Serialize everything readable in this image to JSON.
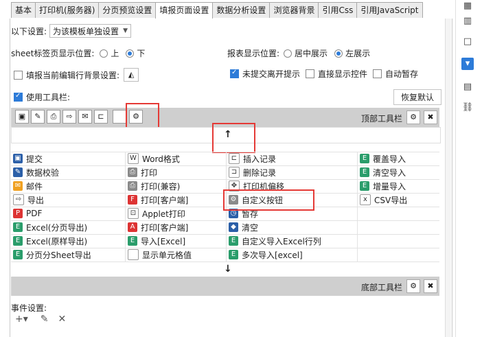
{
  "tabs": [
    "基本",
    "打印机(服务器)",
    "分页预览设置",
    "填报页面设置",
    "数据分析设置",
    "浏览器背景",
    "引用Css",
    "引用JavaScript"
  ],
  "active_tab_index": 3,
  "settings": {
    "label": "以下设置:",
    "select_value": "为该模板单独设置"
  },
  "sheet_tab": {
    "label": "sheet标签页显示位置:",
    "opt1": "上",
    "opt2": "下",
    "selected": "下"
  },
  "report_pos": {
    "label": "报表显示位置:",
    "opt1": "居中展示",
    "opt2": "左展示",
    "selected": "左展示"
  },
  "checks": {
    "fill_bg": "填报当前编辑行背景设置:",
    "unsubmitted": "未提交离开提示",
    "direct_ctrl": "直接显示控件",
    "autosave": "自动暂存",
    "toolbar": "使用工具栏:"
  },
  "restore_default": "恢复默认",
  "top_toolbar_label": "顶部工具栏",
  "bottom_toolbar_label": "底部工具栏",
  "toolbar_icons": [
    "save-icon",
    "verify-icon",
    "print-icon",
    "export-icon",
    "email-icon",
    "tree-icon",
    "blank-icon",
    "gear-icon"
  ],
  "grid": {
    "col1": [
      "提交",
      "数据校验",
      "邮件",
      "导出",
      "PDF",
      "Excel(分页导出)",
      "Excel(原样导出)",
      "分页分Sheet导出"
    ],
    "col2": [
      "Word格式",
      "打印",
      "打印(兼容)",
      "打印[客户端]",
      "Applet打印",
      "打印[客户端]",
      "导入[Excel]",
      "显示单元格值"
    ],
    "col3": [
      "插入记录",
      "删除记录",
      "打印机偏移",
      "自定义按钮",
      "暂存",
      "清空",
      "自定义导入Excel行列",
      "多次导入[excel]"
    ],
    "col4": [
      "覆盖导入",
      "清空导入",
      "增量导入",
      "CSV导出"
    ]
  },
  "event_label": "事件设置:",
  "event_icons": [
    "add-icon",
    "edit-icon",
    "delete-icon"
  ],
  "accent": "#2d7bd8",
  "highlight": "#e53935"
}
